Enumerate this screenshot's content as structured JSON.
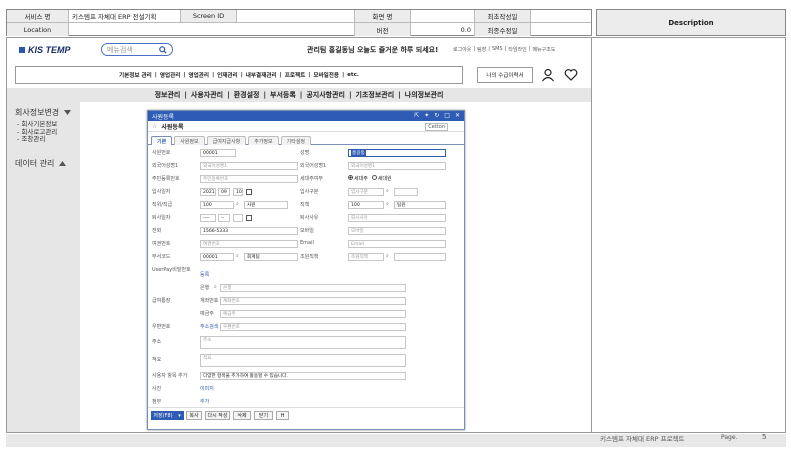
{
  "doc_header": {
    "row1": {
      "label_service": "서비스 명",
      "service": "키스템프 자체대 ERP 전설기획",
      "label_screen_id": "Screen ID",
      "screen_id": "",
      "label_screen_name": "화면 명",
      "screen_name": "",
      "label_first_date": "최초작성일",
      "first_date": ""
    },
    "row2": {
      "label_location": "Location",
      "location": "",
      "label_version": "버전",
      "version": "0.0",
      "label_last_date": "최종수정일",
      "last_date": ""
    },
    "description_label": "Description"
  },
  "topbar": {
    "logo_text": "KIS TEMP",
    "search_placeholder": "메뉴검색",
    "welcome": "관리팀 홍길동님 오늘도 즐거운 하루 되세요!",
    "util_links": [
      "로그아웃",
      "|",
      "팀장",
      "|",
      "SMS",
      "|",
      "타임라인",
      "|",
      "메뉴구조도"
    ]
  },
  "menubar": {
    "items": [
      "기본정보 관리",
      "|",
      "영업관리",
      "|",
      "영업관리",
      "|",
      "인재관리",
      "|",
      "내부결재관리",
      "|",
      "프로젝트",
      "|",
      "모바일전용",
      "|",
      "etc."
    ],
    "message_button": "나의 수급이력서"
  },
  "navbar": {
    "items": [
      "정보관리",
      "|",
      "사용자관리",
      "|",
      "환경설정",
      "|",
      "부서등록",
      "|",
      "공지사항관리",
      "|",
      "기초정보관리",
      "|",
      "나의정보관리"
    ]
  },
  "sidebar": {
    "section1_title": "회사정보변경",
    "section1_items": [
      "-  회사기본정보",
      "-  회사로고관리",
      "-  조창관리"
    ],
    "section2_title": "데이터 관리"
  },
  "modal": {
    "window_title": "사원등록",
    "sub_title": "사원등록",
    "sub_button": "Cetton",
    "tabs": [
      "기본",
      "사원정보",
      "급여지급사항",
      "추가정보",
      "기타설정"
    ],
    "fields": {
      "emp_no_label": "사원번호",
      "emp_no": "00001",
      "name_label": "성명",
      "name": "홍길동",
      "foreign_name1_label": "외국어성명1",
      "foreign_name1_ph": "외국어성명1",
      "foreign_name2_label": "외국어성명1",
      "foreign_name2_ph": "외국어성명1",
      "resident_label": "주민등록번호",
      "resident_ph": "주민등록번호",
      "householder_label": "세대주여부",
      "householder_yes": "세대주",
      "householder_no": "세대원",
      "hire_date_label": "입사일자",
      "hire_year": "2021",
      "hire_month": "09",
      "hire_day": "10",
      "hire_type_label": "입사구분",
      "hire_type_ph": "입사구분",
      "position_label": "직위/직급",
      "position_code": "100",
      "position_name": "사원",
      "duty_label": "직책",
      "duty_code": "100",
      "duty_name": "팀원",
      "leave_date_label": "퇴사일자",
      "leave_year": "----",
      "leave_month": "--",
      "leave_reason_label": "퇴사사유",
      "leave_reason_ph": "퇴사사유",
      "phone_label": "전화",
      "phone": "1566-5333",
      "mobile_label": "모바일",
      "mobile_ph": "모바일",
      "cert_label": "여권번호",
      "cert_ph": "여권번호",
      "email_label": "Email",
      "email_ph": "Email",
      "dept_label": "부서코드",
      "dept_code": "00001",
      "dept_name": "회계팀",
      "card_label": "조원직책",
      "card_ph": "조원직책",
      "userpay_label": "UserPay비밀번호",
      "userpay_value": "등록",
      "bank_label": "은행",
      "bank_ph": "은행",
      "account_label": "급여통장",
      "account_holder_label": "계좌번호",
      "account_holder_ph": "계좌번호",
      "depositor_label": "예금주",
      "depositor_ph": "예금주",
      "zip_label": "우편번호",
      "zip_button": "주소검색",
      "zip_ph": "우편번호",
      "addr_label": "주소",
      "addr_ph": "주소",
      "memo_label": "적요",
      "memo_ph": "적요",
      "extra_label": "사용자 항목 추가",
      "extra_value": "다양한 항목을 추가하여 활용할 수 있습니다.",
      "photo_label": "사진",
      "photo_value": "이미지",
      "attach_label": "첨부",
      "attach_value": "추가"
    },
    "buttons": [
      "저장(F8)",
      "▾",
      "복사",
      "다시 작성",
      "삭제",
      "닫기",
      "H"
    ]
  },
  "footer": {
    "company": "키스템프 자체대 ERP 프로젝트",
    "page_label": "Page.",
    "page_num": "5"
  }
}
